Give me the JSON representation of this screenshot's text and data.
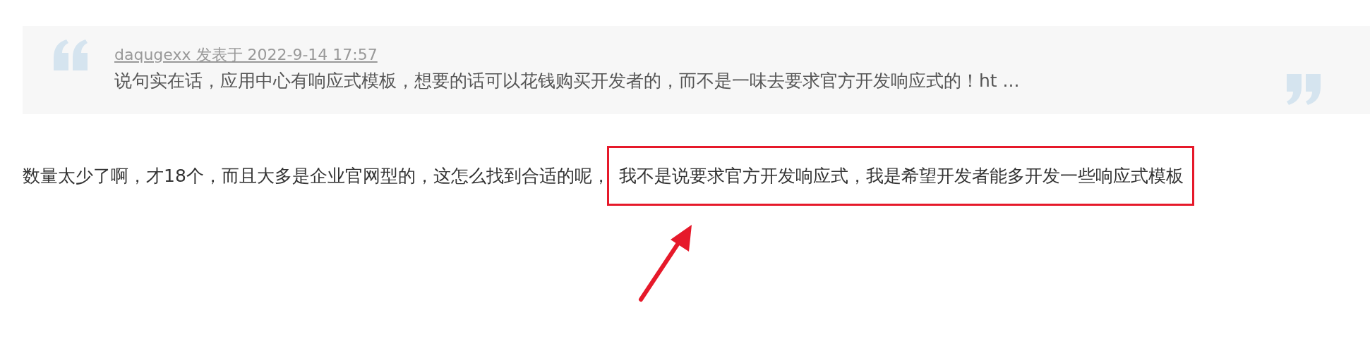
{
  "quote": {
    "author": "daqugexx 发表于 2022-9-14 17:57",
    "text": "说句实在话，应用中心有响应式模板，想要的话可以花钱购买开发者的，而不是一味去要求官方开发响应式的！ht ..."
  },
  "post": {
    "text": "数量太少了啊，才18个，而且大多是企业官网型的，这怎么找到合适的呢，",
    "highlighted": "我不是说要求官方开发响应式，我是希望开发者能多开发一些响应式模板"
  }
}
